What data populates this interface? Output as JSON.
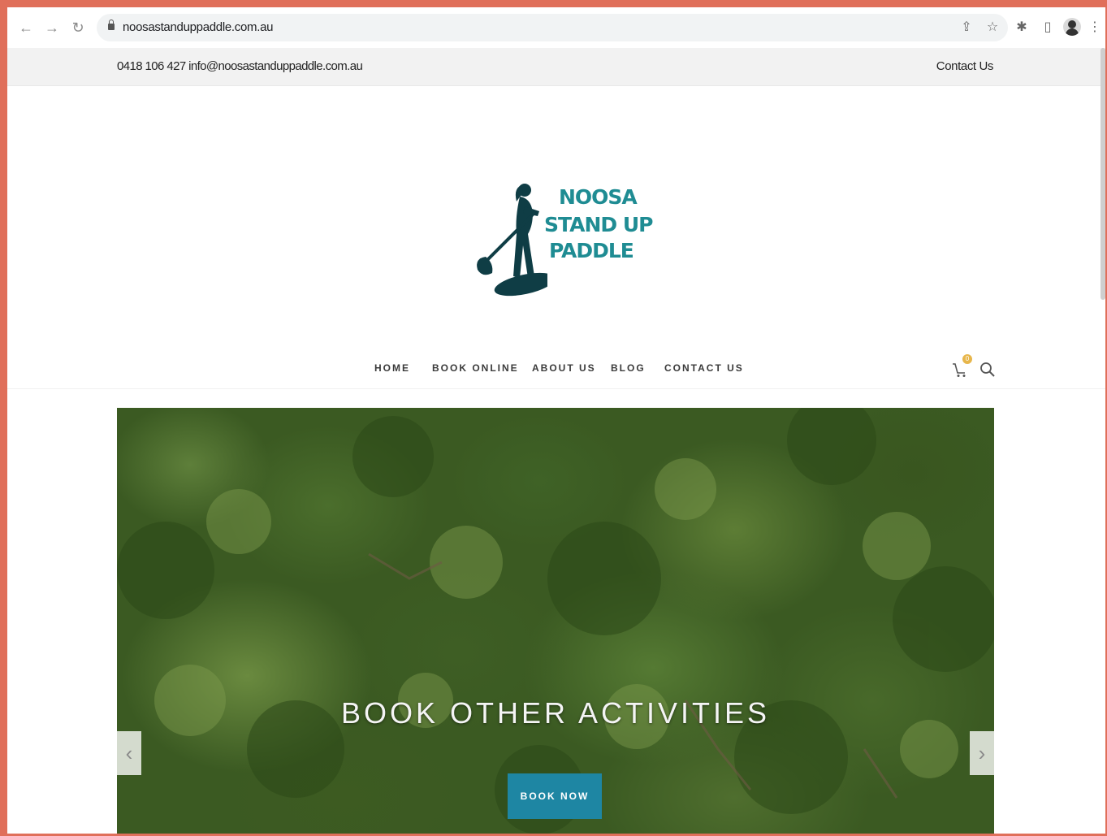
{
  "browser": {
    "url": "noosastanduppaddle.com.au",
    "back_glyph": "←",
    "forward_glyph": "→",
    "reload_glyph": "↻",
    "share_glyph": "⇪",
    "star_glyph": "☆",
    "extensions_glyph": "✱",
    "sidepanel_glyph": "▯",
    "menu_glyph": "⋮"
  },
  "topbar": {
    "contact_info": "0418 106 427 info@noosastanduppaddle.com.au",
    "contact_link": "Contact Us"
  },
  "logo": {
    "line1": "NOOSA",
    "line2": "STAND UP",
    "line3": "PADDLE",
    "color": "#1f8c93",
    "silhouette_color": "#0f3d45"
  },
  "nav": {
    "items": [
      {
        "label": "HOME"
      },
      {
        "label": "BOOK ONLINE"
      },
      {
        "label": "ABOUT US"
      },
      {
        "label": "BLOG"
      },
      {
        "label": "CONTACT US"
      }
    ],
    "cart_count": "0"
  },
  "hero": {
    "title": "BOOK OTHER ACTIVITIES",
    "cta_label": "BOOK NOW",
    "prev_glyph": "‹",
    "next_glyph": "›",
    "cta_color": "#1e86a3"
  },
  "colors": {
    "frame": "#e06f5a",
    "topbar_bg": "#f2f2f2"
  }
}
